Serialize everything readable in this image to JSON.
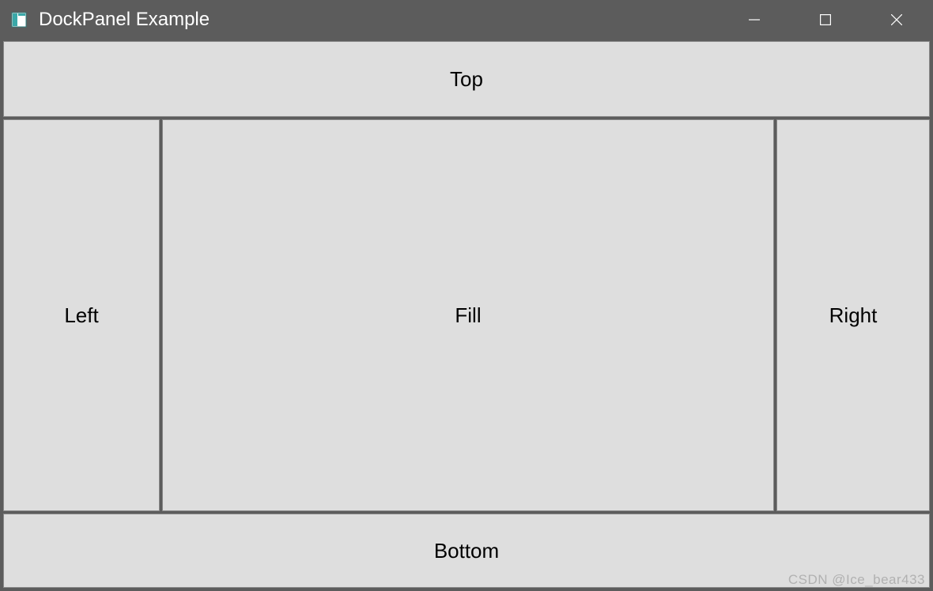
{
  "window": {
    "title": "DockPanel Example"
  },
  "panels": {
    "top": "Top",
    "left": "Left",
    "fill": "Fill",
    "right": "Right",
    "bottom": "Bottom"
  },
  "watermark": "CSDN @Ice_bear433"
}
